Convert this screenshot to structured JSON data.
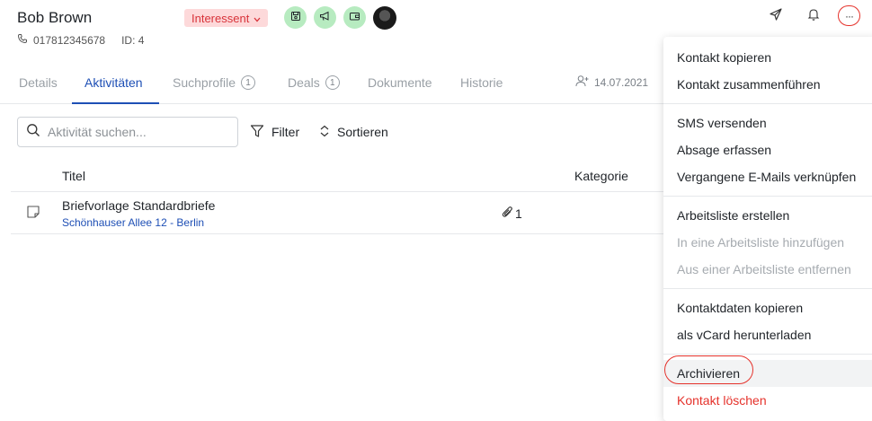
{
  "contact": {
    "name": "Bob Brown",
    "phone": "017812345678",
    "id_label": "ID: 4",
    "status": "Interessent"
  },
  "header_icons": [
    "save-icon",
    "megaphone-icon",
    "wallet-icon",
    "avatar",
    "send-icon",
    "bell-icon",
    "more-icon"
  ],
  "more_button": {
    "label": "···"
  },
  "tabs": [
    {
      "label": "Details"
    },
    {
      "label": "Aktivitäten"
    },
    {
      "label": "Suchprofile",
      "count": "1"
    },
    {
      "label": "Deals",
      "count": "1"
    },
    {
      "label": "Dokumente"
    },
    {
      "label": "Historie"
    }
  ],
  "created_date": "14.07.2021",
  "search": {
    "placeholder": "Aktivität suchen..."
  },
  "toolbar": {
    "filter": "Filter",
    "sort": "Sortieren"
  },
  "table": {
    "columns": [
      "Titel",
      "Kategorie"
    ],
    "rows": [
      {
        "title": "Briefvorlage Standardbriefe",
        "subtitle": "Schönhauser Allee 12 - Berlin",
        "attachments": "1"
      }
    ]
  },
  "menu": {
    "groups": [
      [
        {
          "label": "Kontakt kopieren"
        },
        {
          "label": "Kontakt zusammenführen"
        }
      ],
      [
        {
          "label": "SMS versenden"
        },
        {
          "label": "Absage erfassen"
        },
        {
          "label": "Vergangene E-Mails verknüpfen"
        }
      ],
      [
        {
          "label": "Arbeitsliste erstellen"
        },
        {
          "label": "In eine Arbeitsliste hinzufügen",
          "disabled": true
        },
        {
          "label": "Aus einer Arbeitsliste entfernen",
          "disabled": true
        }
      ],
      [
        {
          "label": "Kontaktdaten kopieren"
        },
        {
          "label": "als vCard herunterladen"
        }
      ],
      [
        {
          "label": "Archivieren"
        },
        {
          "label": "Kontakt löschen",
          "danger": true
        }
      ]
    ]
  },
  "colors": {
    "accent": "#1e4fb5",
    "danger": "#e5322b",
    "badge_bg": "#fdd9da",
    "icon_bg": "#b7ebc0"
  }
}
